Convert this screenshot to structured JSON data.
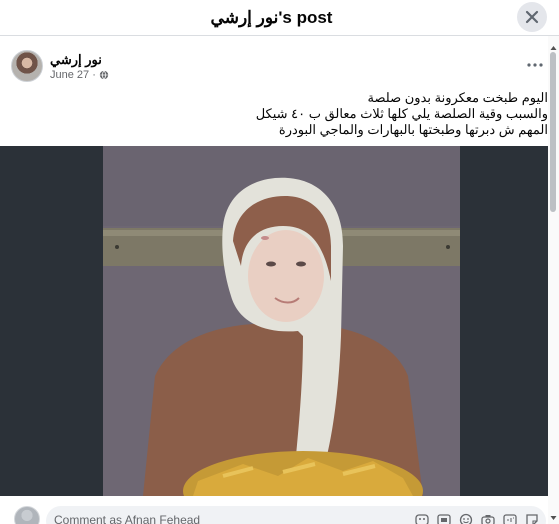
{
  "header": {
    "title": "نور إرشي's post",
    "close_icon": "close-icon"
  },
  "post": {
    "author": "نور إرشي",
    "date": "June 27 ·",
    "privacy_icon": "globe-icon",
    "more_icon": "more-horizontal-icon",
    "text_lines": [
      "اليوم طبخت معكرونة بدون صلصة",
      "والسبب وقية الصلصة يلي كلها ثلاث معالق  ب ٤٠ شيكل",
      "المهم ش دبرتها وطبختها بالبهارات والماجي  البودرة"
    ],
    "photo_description_icon": "photo"
  },
  "comment": {
    "placeholder": "Comment as Afnan Fehead",
    "icons": [
      "sticker-icon",
      "gif-icon",
      "emoji-icon",
      "camera-icon",
      "gif-square-icon",
      "sticker-face-icon"
    ]
  },
  "colors": {
    "header_bg": "#ffffff",
    "comment_bg": "#f0f2f5",
    "secondary_text": "#65676b",
    "close_bg": "#e4e6eb"
  }
}
